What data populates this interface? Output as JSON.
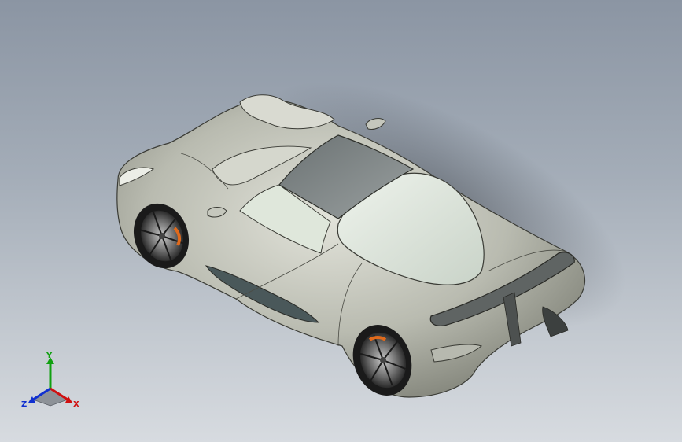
{
  "triad": {
    "x_label": "X",
    "y_label": "Y",
    "z_label": "Z",
    "x_color": "#d01010",
    "y_color": "#10a010",
    "z_color": "#1030d0"
  },
  "colors": {
    "body": "#c8c9bf",
    "body_dark": "#8c8d82",
    "glass_light": "#e4ebe2",
    "roof": "#7d8384",
    "brake_caliper": "#e06a1c",
    "tire": "#1a1a1a"
  }
}
